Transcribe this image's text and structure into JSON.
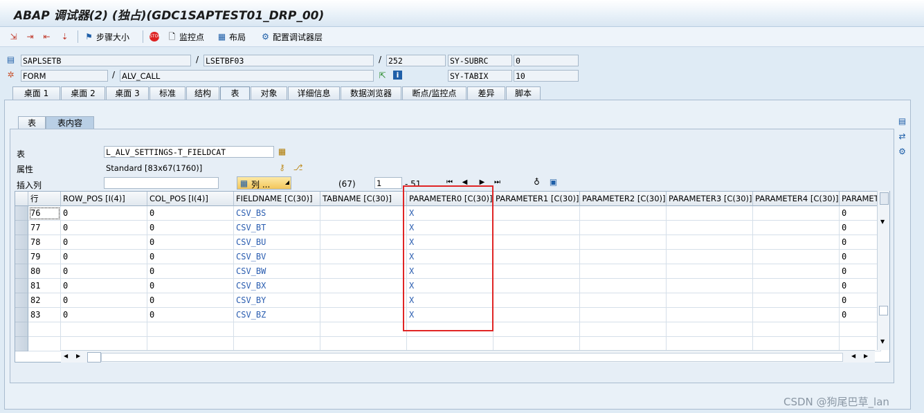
{
  "window": {
    "title": "ABAP 调试器(2) (独占)(GDC1SAPTEST01_DRP_00)"
  },
  "toolbar": {
    "step_size_label": "步骤大小",
    "watchpoint_label": "监控点",
    "layout_label": "布局",
    "config_layer_label": "配置调试器层"
  },
  "info": {
    "program": "SAPLSETB",
    "include": "LSETBF03",
    "line": "252",
    "event_type": "FORM",
    "event_name": "ALV_CALL",
    "sysvar1_name": "SY-SUBRC",
    "sysvar1_value": "0",
    "sysvar2_name": "SY-TABIX",
    "sysvar2_value": "10",
    "slash": "/"
  },
  "tabs": [
    "桌面 1",
    "桌面 2",
    "桌面 3",
    "标准",
    "结构",
    "表",
    "对象",
    "详细信息",
    "数据浏览器",
    "断点/监控点",
    "差异",
    "脚本"
  ],
  "subtabs": [
    "表",
    "表内容"
  ],
  "table_controls": {
    "table_label": "表",
    "table_value": "L_ALV_SETTINGS-T_FIELDCAT",
    "attr_label": "属性",
    "attr_value": "Standard [83x67(1760)]",
    "insert_col_label": "插入列",
    "col_button_label": "列 ...",
    "col_count": "(67)",
    "from_value": "1",
    "to_label": "- 51"
  },
  "grid": {
    "headers": [
      "行",
      "ROW_POS [I(4)]",
      "COL_POS [I(4)]",
      "FIELDNAME [C(30)]",
      "TABNAME [C(30)]",
      "PARAMETER0 [C(30)]",
      "PARAMETER1 [C(30)]",
      "PARAMETER2 [C(30)]",
      "PARAMETER3 [C(30)]",
      "PARAMETER4 [C(30)]",
      "PARAMET"
    ],
    "rows": [
      [
        "76",
        "0",
        "0",
        "CSV_BS",
        "",
        "X",
        "",
        "",
        "",
        "",
        "0"
      ],
      [
        "77",
        "0",
        "0",
        "CSV_BT",
        "",
        "X",
        "",
        "",
        "",
        "",
        "0"
      ],
      [
        "78",
        "0",
        "0",
        "CSV_BU",
        "",
        "X",
        "",
        "",
        "",
        "",
        "0"
      ],
      [
        "79",
        "0",
        "0",
        "CSV_BV",
        "",
        "X",
        "",
        "",
        "",
        "",
        "0"
      ],
      [
        "80",
        "0",
        "0",
        "CSV_BW",
        "",
        "X",
        "",
        "",
        "",
        "",
        "0"
      ],
      [
        "81",
        "0",
        "0",
        "CSV_BX",
        "",
        "X",
        "",
        "",
        "",
        "",
        "0"
      ],
      [
        "82",
        "0",
        "0",
        "CSV_BY",
        "",
        "X",
        "",
        "",
        "",
        "",
        "0"
      ],
      [
        "83",
        "0",
        "0",
        "CSV_BZ",
        "",
        "X",
        "",
        "",
        "",
        "",
        "0"
      ]
    ]
  },
  "watermark": "CSDN @狗尾巴草_lan",
  "colors": {
    "highlight": "#e02424",
    "link_blue": "#2a5db0"
  }
}
